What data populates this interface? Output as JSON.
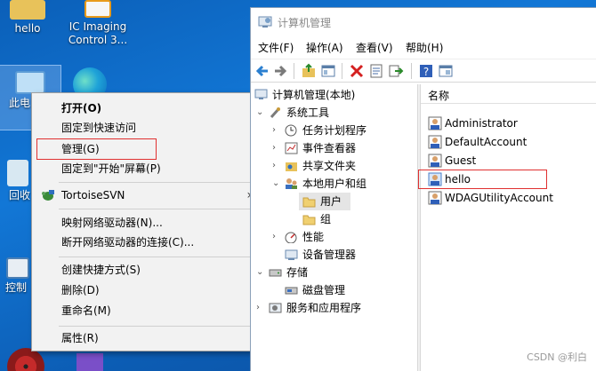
{
  "desktop": {
    "icons": [
      {
        "label": "hello"
      },
      {
        "label": "IC Imaging Control 3..."
      },
      {
        "label": "此电"
      },
      {
        "label": "回收"
      },
      {
        "label": "控制"
      }
    ]
  },
  "context_menu": {
    "items": [
      {
        "label": "打开(O)"
      },
      {
        "label": "固定到快速访问"
      },
      {
        "label": "管理(G)"
      },
      {
        "label": "固定到\"开始\"屏幕(P)"
      },
      {
        "label": "TortoiseSVN"
      },
      {
        "label": "映射网络驱动器(N)..."
      },
      {
        "label": "断开网络驱动器的连接(C)..."
      },
      {
        "label": "创建快捷方式(S)"
      },
      {
        "label": "删除(D)"
      },
      {
        "label": "重命名(M)"
      },
      {
        "label": "属性(R)"
      }
    ],
    "submenu_arrow": "›"
  },
  "window": {
    "title": "计算机管理",
    "menu": [
      "文件(F)",
      "操作(A)",
      "查看(V)",
      "帮助(H)"
    ],
    "toolbar_icons": [
      "back-arrow-icon",
      "forward-arrow-icon",
      "up-folder-icon",
      "show-tree-icon",
      "delete-icon",
      "properties-icon",
      "export-icon",
      "help-icon",
      "view-icon"
    ],
    "tree": [
      {
        "label": "计算机管理(本地)",
        "expander": ""
      },
      {
        "label": "系统工具",
        "expander": "⌄"
      },
      {
        "label": "任务计划程序",
        "expander": "›"
      },
      {
        "label": "事件查看器",
        "expander": "›"
      },
      {
        "label": "共享文件夹",
        "expander": "›"
      },
      {
        "label": "本地用户和组",
        "expander": "⌄"
      },
      {
        "label": "用户",
        "expander": ""
      },
      {
        "label": "组",
        "expander": ""
      },
      {
        "label": "性能",
        "expander": "›"
      },
      {
        "label": "设备管理器",
        "expander": ""
      },
      {
        "label": "存储",
        "expander": "⌄"
      },
      {
        "label": "磁盘管理",
        "expander": ""
      },
      {
        "label": "服务和应用程序",
        "expander": "›"
      }
    ],
    "list_header": "名称",
    "users": [
      {
        "name": "Administrator"
      },
      {
        "name": "DefaultAccount"
      },
      {
        "name": "Guest"
      },
      {
        "name": "hello"
      },
      {
        "name": "WDAGUtilityAccount"
      }
    ]
  },
  "watermark": "CSDN @利白",
  "colors": {
    "highlight_box": "#e03030",
    "selection": "#e5e5e5",
    "desktop": "#1277d6"
  }
}
